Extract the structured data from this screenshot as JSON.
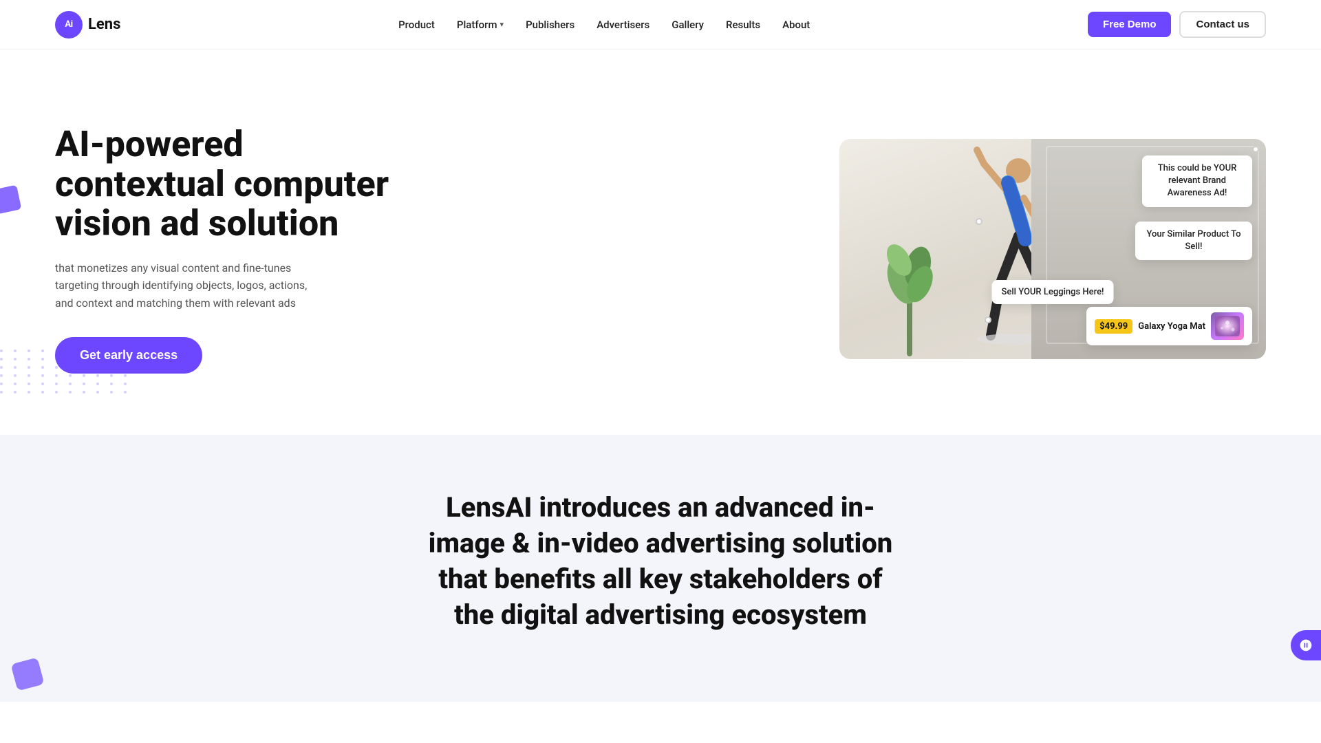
{
  "brand": {
    "logo_icon_text": "Ai",
    "logo_name": "Lens"
  },
  "nav": {
    "links": [
      {
        "id": "product",
        "label": "Product",
        "has_dropdown": false
      },
      {
        "id": "platform",
        "label": "Platform",
        "has_dropdown": true
      },
      {
        "id": "publishers",
        "label": "Publishers",
        "has_dropdown": false
      },
      {
        "id": "advertisers",
        "label": "Advertisers",
        "has_dropdown": false
      },
      {
        "id": "gallery",
        "label": "Gallery",
        "has_dropdown": false
      },
      {
        "id": "results",
        "label": "Results",
        "has_dropdown": false
      },
      {
        "id": "about",
        "label": "About",
        "has_dropdown": false
      }
    ],
    "free_demo_label": "Free Demo",
    "contact_label": "Contact us"
  },
  "hero": {
    "title": "AI-powered contextual computer vision ad solution",
    "description": "that monetizes any visual content and fine-tunes targeting through identifying objects, logos, actions, and context and matching them with relevant ads",
    "cta_label": "Get early access"
  },
  "ad_overlays": {
    "brand_awareness": "This could be YOUR relevant Brand Awareness Ad!",
    "similar_product": "Your Similar Product To Sell!",
    "leggings": "Sell YOUR Leggings Here!",
    "price": "$49.99",
    "product_name": "Galaxy Yoga Mat"
  },
  "bottom": {
    "title": "LensAI introduces an advanced in-image & in-video advertising solution that benefits all key stakeholders of the digital advertising ecosystem"
  },
  "colors": {
    "primary": "#6c47ff",
    "text_dark": "#111111",
    "text_muted": "#555555"
  }
}
